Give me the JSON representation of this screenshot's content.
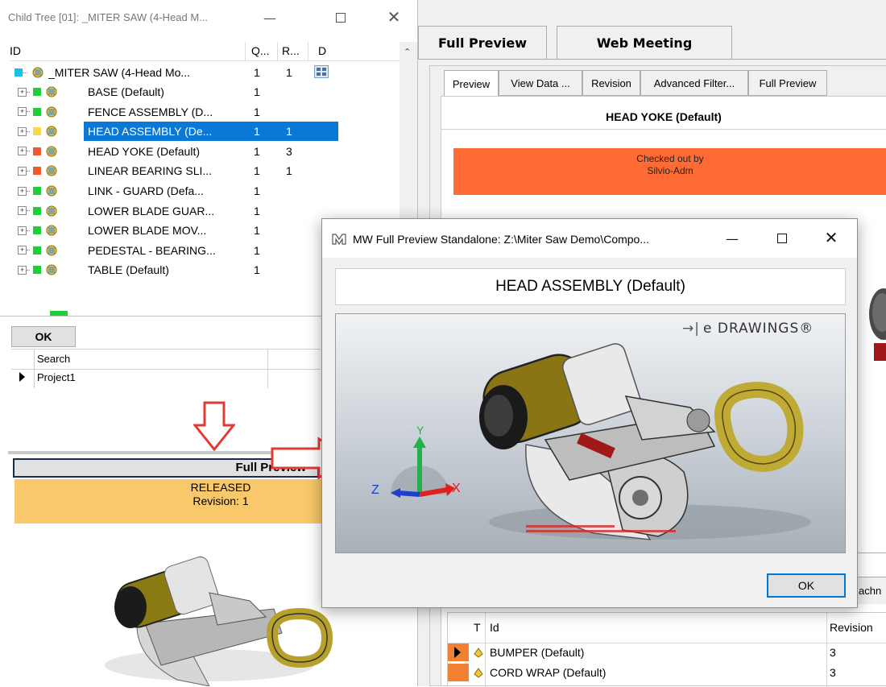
{
  "right_app": {
    "tabs": [
      "Full Preview",
      "Web Meeting"
    ],
    "subtabs": [
      "Preview",
      "View Data ...",
      "Revision",
      "Advanced Filter...",
      "Full Preview"
    ],
    "part_title": "HEAD YOKE (Default)",
    "checked_out_line1": "Checked out by",
    "checked_out_line2": "Silvio-Adm",
    "attach_tab": "achn",
    "grid_headers": {
      "t": "T",
      "id": "Id",
      "revision": "Revision"
    },
    "grid_rows": [
      {
        "id": "BUMPER (Default)",
        "revision": "3"
      },
      {
        "id": "CORD WRAP (Default)",
        "revision": "3"
      }
    ],
    "colors": {
      "checked_out": "#ff6b35"
    }
  },
  "child_tree": {
    "title": "Child Tree [01]: _MITER SAW (4-Head M...",
    "headers": {
      "id": "ID",
      "q": "Q...",
      "r": "R...",
      "d": "D"
    },
    "root": {
      "label": "_MITER SAW (4-Head Mo...",
      "q": "1",
      "r": "1"
    },
    "items": [
      {
        "label": "BASE (Default)",
        "q": "1",
        "r": "",
        "status": "green"
      },
      {
        "label": "FENCE ASSEMBLY (D...",
        "q": "1",
        "r": "",
        "status": "green"
      },
      {
        "label": "HEAD ASSEMBLY (De...",
        "q": "1",
        "r": "1",
        "status": "yellow",
        "selected": true
      },
      {
        "label": "HEAD YOKE (Default)",
        "q": "1",
        "r": "3",
        "status": "red"
      },
      {
        "label": "LINEAR BEARING SLI...",
        "q": "1",
        "r": "1",
        "status": "red"
      },
      {
        "label": "LINK - GUARD (Defa...",
        "q": "1",
        "r": "",
        "status": "green"
      },
      {
        "label": "LOWER BLADE GUAR...",
        "q": "1",
        "r": "",
        "status": "green"
      },
      {
        "label": "LOWER BLADE MOV...",
        "q": "1",
        "r": "",
        "status": "green"
      },
      {
        "label": "PEDESTAL - BEARING...",
        "q": "1",
        "r": "",
        "status": "green"
      },
      {
        "label": "TABLE (Default)",
        "q": "1",
        "r": "",
        "status": "green"
      }
    ],
    "ok_button": "OK",
    "search_header": "Search",
    "search_row": "Project1",
    "full_preview_button": "Full Preview",
    "status_line1": "RELEASED",
    "status_line2": "Revision: 1",
    "colors": {
      "released": "#f9c86a",
      "selected": "#0a78d7",
      "arrow": "#e53935"
    }
  },
  "dialog": {
    "title": "MW Full Preview Standalone: Z:\\Miter Saw Demo\\Compo...",
    "header": "HEAD ASSEMBLY (Default)",
    "edrawings_logo": "e DRAWINGS®",
    "axis_x": "X",
    "axis_y": "Y",
    "axis_z": "Z",
    "ok_button": "OK"
  }
}
